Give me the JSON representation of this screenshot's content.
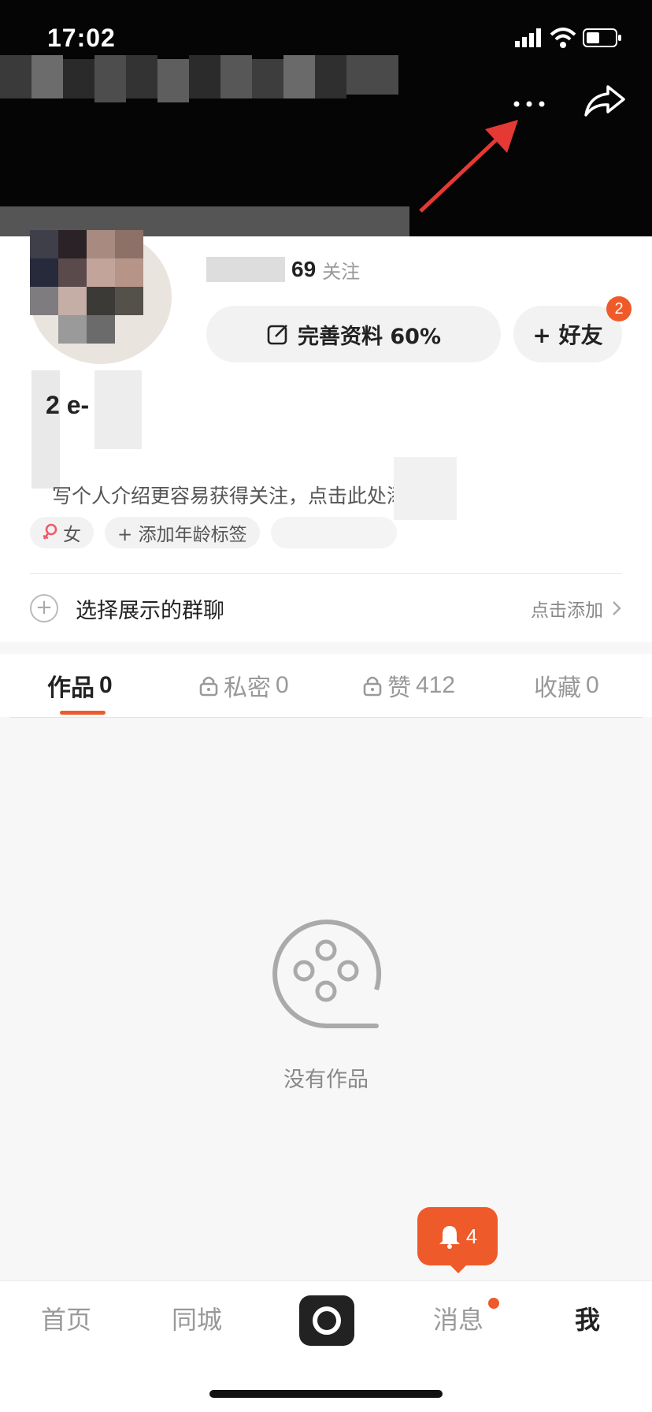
{
  "status_bar": {
    "time": "17:02"
  },
  "profile": {
    "following_count": "69",
    "following_label": "关注",
    "complete_profile_label": "完善资料 60%",
    "add_friend_label": "+ 好友",
    "friend_badge_count": "2",
    "name_partial": "2      e-",
    "bio_placeholder": "写个人介绍更容易获得关注，点击此处添",
    "tags": [
      {
        "label": "女",
        "icon": "female-icon"
      },
      {
        "label": "+ 添加年龄标签",
        "icon": ""
      }
    ],
    "group_chat": {
      "label": "选择展示的群聊",
      "action": "点击添加"
    }
  },
  "tabs": [
    {
      "label": "作品",
      "count": "0",
      "locked": false,
      "active": true
    },
    {
      "label": "私密",
      "count": "0",
      "locked": true,
      "active": false
    },
    {
      "label": "赞",
      "count": "412",
      "locked": true,
      "active": false
    },
    {
      "label": "收藏",
      "count": "0",
      "locked": false,
      "active": false
    }
  ],
  "empty_state": {
    "text": "没有作品",
    "icon": "film-reel-icon"
  },
  "notification_bubble": {
    "count": "4",
    "icon": "bell-icon"
  },
  "bottom_nav": {
    "items": [
      {
        "label": "首页",
        "active": false
      },
      {
        "label": "同城",
        "active": false
      },
      {
        "label": "",
        "icon": "camera-record-icon"
      },
      {
        "label": "消息",
        "active": false,
        "has_dot": true
      },
      {
        "label": "我",
        "active": true
      }
    ]
  },
  "colors": {
    "accent": "#ef5a2a",
    "header_bg": "#050505",
    "page_bg": "#f7f7f7"
  }
}
